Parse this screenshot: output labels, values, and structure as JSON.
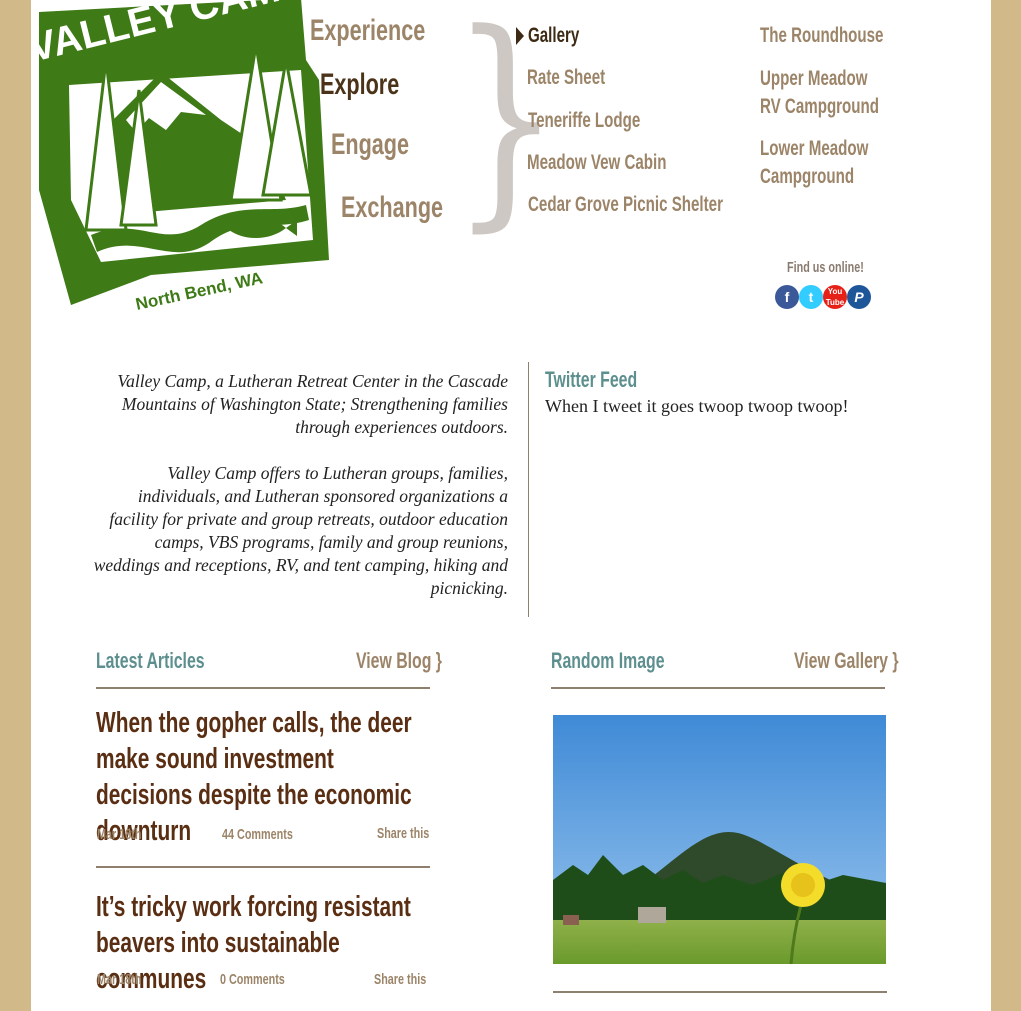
{
  "logo": {
    "title": "VALLEY CAMP",
    "location": "North Bend, WA"
  },
  "nav": {
    "main": [
      "Experience",
      "Explore",
      "Engage",
      "Exchange"
    ],
    "active_main": "Explore",
    "sub_col1": [
      "Gallery",
      "Rate Sheet",
      "Teneriffe Lodge",
      "Meadow Vew Cabin",
      "Cedar Grove Picnic Shelter"
    ],
    "sub_col2": [
      "The Roundhouse",
      "Upper Meadow RV Campground",
      "Lower Meadow Campground"
    ],
    "sub_col2_lines": [
      [
        "The Roundhouse"
      ],
      [
        "Upper Meadow",
        "RV Campground"
      ],
      [
        "Lower Meadow",
        "Campground"
      ]
    ],
    "active_sub": "Gallery"
  },
  "social": {
    "label": "Find us online!",
    "icons": [
      "facebook-icon",
      "twitter-icon",
      "youtube-icon",
      "paypal-icon"
    ],
    "colors": [
      "#3b5998",
      "#33ccff",
      "#e62117",
      "#1e5799"
    ]
  },
  "intro": {
    "p1": "Valley Camp, a Lutheran Retreat Center in the Cascade Mountains of Washington State; Strengthening families through experiences outdoors.",
    "p2": "Valley Camp offers to Lutheran groups, families, individuals, and Lutheran sponsored organizations a facility for private and group retreats, outdoor education camps, VBS programs, family and group reunions, weddings and receptions, RV, and tent camping, hiking and picnicking."
  },
  "twitter": {
    "title": "Twitter Feed",
    "text": "When I tweet it goes twoop twoop twoop!"
  },
  "articles": {
    "title": "Latest Articles",
    "link": "View Blog }",
    "items": [
      {
        "title": "When the gopher calls, the deer make sound investment decisions despite the economic downturn",
        "date": "Mar 18th",
        "comments": "44 Comments",
        "share": "Share this"
      },
      {
        "title": "It’s tricky work forcing resistant beavers into sustainable communes",
        "date": "Mar 18th",
        "comments": "0 Comments",
        "share": "Share this"
      }
    ]
  },
  "gallery": {
    "title": "Random Image",
    "link": "View Gallery }"
  },
  "colors": {
    "background": "#d2b98a",
    "logo_green": "#3e7a16",
    "nav_brown": "#9c8468",
    "active_brown": "#4a3318",
    "teal": "#5e8f8f",
    "article_title": "#5a2e12"
  }
}
